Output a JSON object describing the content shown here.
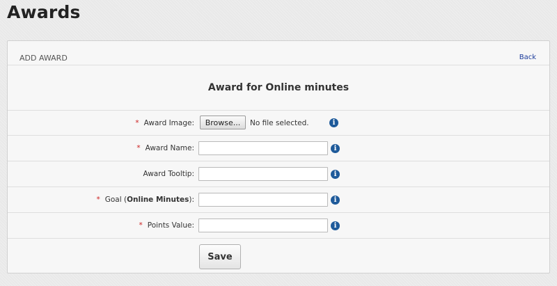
{
  "page": {
    "title": "Awards"
  },
  "panel": {
    "subtitle": "ADD AWARD",
    "back_label": "Back",
    "form_heading": "Award for Online minutes"
  },
  "form": {
    "award_image": {
      "required_mark": "*",
      "label": "Award Image:",
      "browse_label": "Browse...",
      "file_status": "No file selected.",
      "info_icon": "info-icon"
    },
    "award_name": {
      "required_mark": "*",
      "label": "Award Name:",
      "value": "",
      "info_icon": "info-icon"
    },
    "award_tooltip": {
      "label": "Award Tooltip:",
      "value": "",
      "info_icon": "info-icon"
    },
    "goal": {
      "required_mark": "*",
      "label_prefix": "Goal (",
      "label_bold": "Online Minutes",
      "label_suffix": "):",
      "value": "",
      "info_icon": "info-icon"
    },
    "points_value": {
      "required_mark": "*",
      "label": "Points Value:",
      "value": "",
      "info_icon": "info-icon"
    },
    "save_label": "Save"
  },
  "colors": {
    "background": "#e9e9e9",
    "panel": "#f7f7f7",
    "required": "#cc2222",
    "link": "#1a3a9a",
    "info_icon": "#1e5a9a"
  }
}
